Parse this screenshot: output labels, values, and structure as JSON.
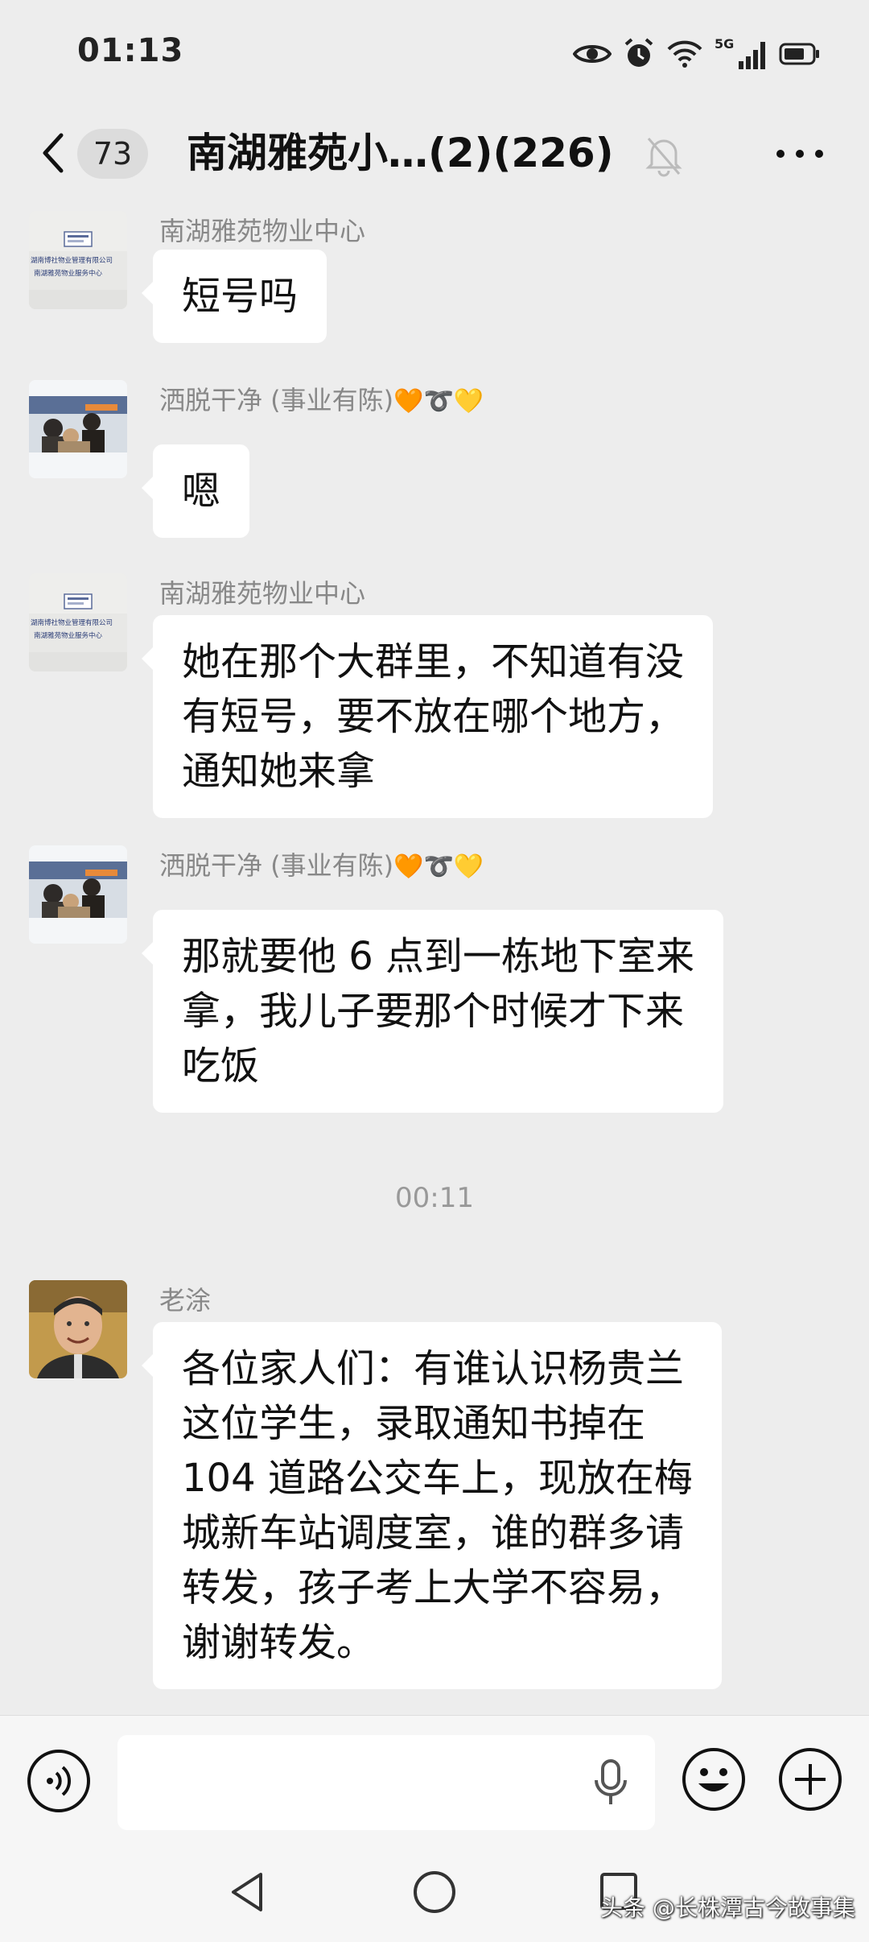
{
  "status_bar": {
    "time": "01:13",
    "network": "5G"
  },
  "header": {
    "back_icon": "chevron-left-icon",
    "unread_badge": "73",
    "title": "南湖雅苑小…(2)(226)",
    "mute_icon": "bell-off-icon",
    "more_icon": "more-horizontal-icon"
  },
  "messages": [
    {
      "sender": "南湖雅苑物业中心",
      "lines": [
        "短号吗"
      ]
    },
    {
      "sender": "洒脱干净 (事业有陈)",
      "sender_emoji": "🧡➰💛",
      "lines": [
        "嗯"
      ]
    },
    {
      "sender": "南湖雅苑物业中心",
      "lines": [
        "她在那个大群里，不知道有没",
        "有短号，要不放在哪个地方，",
        "通知她来拿"
      ]
    },
    {
      "sender": "洒脱干净 (事业有陈)",
      "sender_emoji": "🧡➰💛",
      "lines": [
        "那就要他 6 点到一栋地下室来",
        "拿，我儿子要那个时候才下来",
        "吃饭"
      ]
    },
    {
      "sender": "老涂",
      "lines": [
        "各位家人们：有谁认识杨贵兰",
        "这位学生，录取通知书掉在",
        "104 道路公交车上，现放在梅",
        "城新车站调度室，谁的群多请",
        "转发，孩子考上大学不容易，",
        "谢谢转发。"
      ]
    }
  ],
  "timestamp": "00:11",
  "avatar_logo_text": [
    "湖南博社物业管理有限公司",
    "南湖雅苑物业服务中心"
  ],
  "input_bar": {
    "voice_icon": "voice-icon",
    "mic_icon": "microphone-icon",
    "emoji_icon": "emoji-icon",
    "plus_icon": "plus-icon",
    "placeholder": ""
  },
  "nav_bar": {
    "watermark": "头条 @长株潭古今故事集"
  },
  "colors": {
    "background": "#ededed",
    "bubble": "#ffffff",
    "meta_text": "#888888"
  }
}
